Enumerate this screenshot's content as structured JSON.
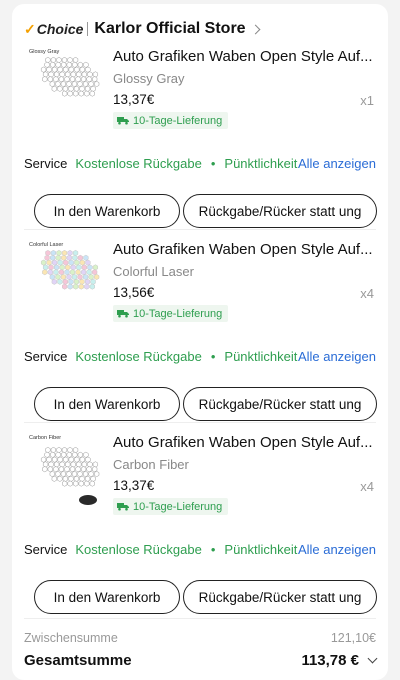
{
  "store": {
    "badge_check": "✓",
    "badge": "Choice",
    "name": "Karlor Official Store"
  },
  "items": [
    {
      "thumb_label": "Glossy Gray",
      "title": "Auto Grafiken Waben Open Style Auf...",
      "variant": "Glossy Gray",
      "price": "13,37€",
      "qty": "x1",
      "delivery": "10-Tage-Lieferung",
      "service_label": "Service",
      "service_return": "Kostenlose Rückgabe",
      "service_dot": "•",
      "service_punctual": "Pünktlichkeit",
      "service_all": "Alle anzeigen",
      "cart_label": "In den Warenkorb",
      "return_label": "Rückgabe/Rücker statt ung"
    },
    {
      "thumb_label": "Colorful Laser",
      "title": "Auto Grafiken Waben Open Style Auf...",
      "variant": "Colorful Laser",
      "price": "13,56€",
      "qty": "x4",
      "delivery": "10-Tage-Lieferung",
      "service_label": "Service",
      "service_return": "Kostenlose Rückgabe",
      "service_dot": "•",
      "service_punctual": "Pünktlichkeit",
      "service_all": "Alle anzeigen",
      "cart_label": "In den Warenkorb",
      "return_label": "Rückgabe/Rücker statt ung"
    },
    {
      "thumb_label": "Carbon Fiber",
      "title": "Auto Grafiken Waben Open Style Auf...",
      "variant": "Carbon Fiber",
      "price": "13,37€",
      "qty": "x4",
      "delivery": "10-Tage-Lieferung",
      "service_label": "Service",
      "service_return": "Kostenlose Rückgabe",
      "service_dot": "•",
      "service_punctual": "Pünktlichkeit",
      "service_all": "Alle anzeigen",
      "cart_label": "In den Warenkorb",
      "return_label": "Rückgabe/Rücker statt ung"
    }
  ],
  "summary": {
    "subtotal_label": "Zwischensumme",
    "subtotal_value": "121,10€",
    "total_label": "Gesamtsumme",
    "total_value": "113,78 €"
  },
  "colors": {
    "accent_green": "#2e9e4f",
    "link_blue": "#2a6cd6",
    "choice_gold": "#f4a000"
  },
  "icons": {
    "delivery": "truck-icon",
    "store_link": "chevron-right-icon",
    "total_expand": "chevron-down-icon"
  }
}
